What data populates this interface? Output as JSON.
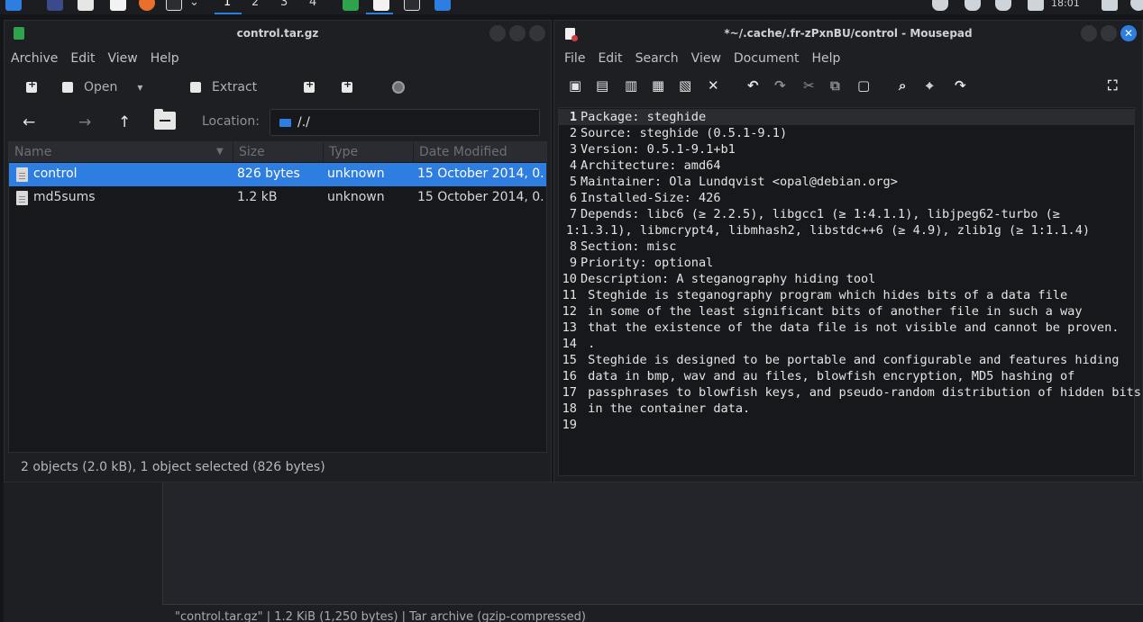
{
  "panel": {
    "workspaces": [
      "1",
      "2",
      "3",
      "4"
    ],
    "clock": "18:01"
  },
  "archive": {
    "title": "control.tar.gz",
    "menu": [
      "Archive",
      "Edit",
      "View",
      "Help"
    ],
    "toolbar": {
      "open": "Open",
      "extract": "Extract"
    },
    "location_label": "Location:",
    "location_value": "/./",
    "columns": [
      "Name",
      "Size",
      "Type",
      "Date Modified"
    ],
    "files": [
      {
        "name": "control",
        "size": "826 bytes",
        "type": "unknown",
        "date": "15 October 2014, 0..."
      },
      {
        "name": "md5sums",
        "size": "1.2 kB",
        "type": "unknown",
        "date": "15 October 2014, 0..."
      }
    ],
    "status": "2 objects (2.0 kB), 1 object selected (826 bytes)"
  },
  "mousepad": {
    "title": "*~/.cache/.fr-zPxnBU/control - Mousepad",
    "menu": [
      "File",
      "Edit",
      "Search",
      "View",
      "Document",
      "Help"
    ],
    "lines": [
      {
        "n": "1",
        "text": "Package: steghide"
      },
      {
        "n": "2",
        "text": "Source: steghide (0.5.1-9.1)"
      },
      {
        "n": "3",
        "text": "Version: 0.5.1-9.1+b1"
      },
      {
        "n": "4",
        "text": "Architecture: amd64"
      },
      {
        "n": "5",
        "text": "Maintainer: Ola Lundqvist <opal@debian.org>"
      },
      {
        "n": "6",
        "text": "Installed-Size: 426"
      },
      {
        "n": "7",
        "text": "Depends: libc6 (≥ 2.2.5), libgcc1 (≥ 1:4.1.1), libjpeg62-turbo (≥"
      },
      {
        "n": "",
        "text": "1:1.3.1), libmcrypt4, libmhash2, libstdc++6 (≥ 4.9), zlib1g (≥ 1:1.1.4)"
      },
      {
        "n": "8",
        "text": "Section: misc"
      },
      {
        "n": "9",
        "text": "Priority: optional"
      },
      {
        "n": "10",
        "text": "Description: A steganography hiding tool"
      },
      {
        "n": "11",
        "text": " Steghide is steganography program which hides bits of a data file"
      },
      {
        "n": "12",
        "text": " in some of the least significant bits of another file in such a way"
      },
      {
        "n": "13",
        "text": " that the existence of the data file is not visible and cannot be proven."
      },
      {
        "n": "14",
        "text": " ."
      },
      {
        "n": "15",
        "text": " Steghide is designed to be portable and configurable and features hiding"
      },
      {
        "n": "16",
        "text": " data in bmp, wav and au files, blowfish encryption, MD5 hashing of"
      },
      {
        "n": "17",
        "text": " passphrases to blowfish keys, and pseudo-random distribution of hidden bits"
      },
      {
        "n": "18",
        "text": " in the container data."
      },
      {
        "n": "19",
        "text": ""
      }
    ]
  },
  "background": {
    "status": "\"control.tar.gz\" | 1.2 KiB (1,250 bytes) | Tar archive (gzip-compressed)"
  }
}
